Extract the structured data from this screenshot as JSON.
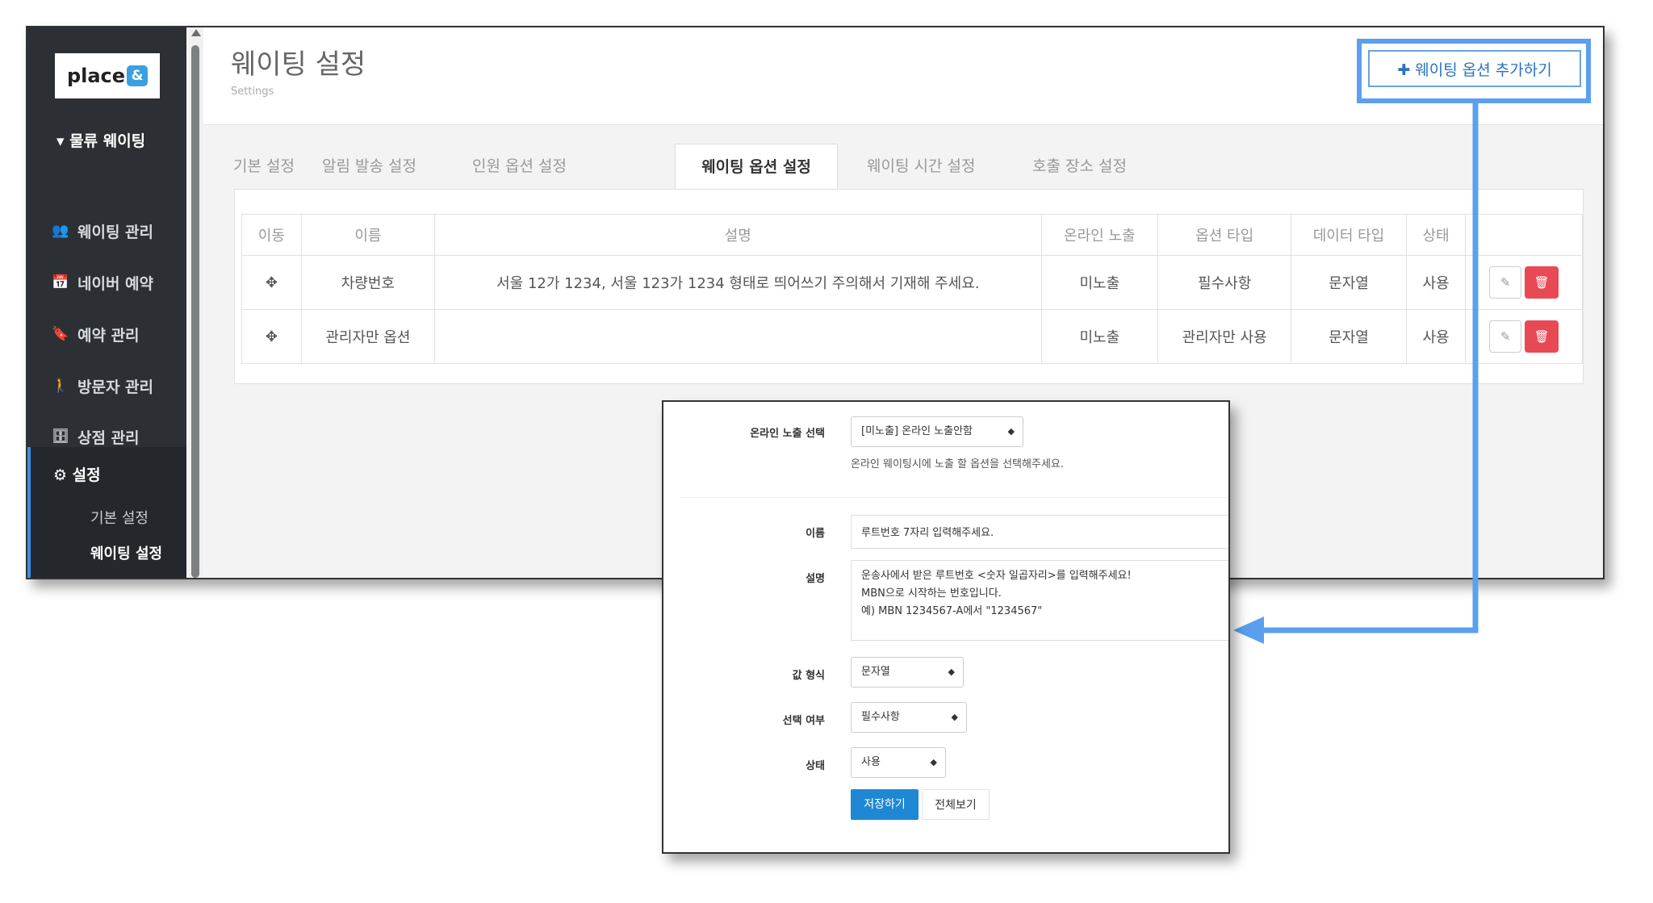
{
  "sidebar": {
    "logo_text": "place",
    "logo_mark": "&",
    "group_label": "▾ 물류 웨이팅",
    "items": [
      {
        "icon": "user-plus-icon",
        "glyph": "👥",
        "label": "웨이팅 관리"
      },
      {
        "icon": "calendar-icon",
        "glyph": "📅",
        "label": "네이버 예약"
      },
      {
        "icon": "bookmark-icon",
        "glyph": "🔖",
        "label": "예약 관리"
      },
      {
        "icon": "person-icon",
        "glyph": "🚶",
        "label": "방문자 관리"
      },
      {
        "icon": "store-icon",
        "glyph": "🗄",
        "label": "상점 관리"
      }
    ],
    "settings": {
      "icon": "gear-icon",
      "label": "설정",
      "subitems": [
        "기본 설정",
        "웨이팅 설정"
      ]
    }
  },
  "header": {
    "title": "웨이팅 설정",
    "subtitle": "Settings",
    "add_button": "✚ 웨이팅 옵션 추가하기"
  },
  "tabs": [
    "기본 설정",
    "알림 발송 설정",
    "인원 옵션 설정",
    "웨이팅 옵션 설정",
    "웨이팅 시간 설정",
    "호출 장소 설정"
  ],
  "table": {
    "headers": [
      "이동",
      "이름",
      "설명",
      "온라인 노출",
      "옵션 타입",
      "데이터 타입",
      "상태",
      ""
    ],
    "rows": [
      {
        "name": "차량번호",
        "description": "서울 12가 1234, 서울 123가 1234 형태로 띄어쓰기 주의해서 기재해 주세요.",
        "online": "미노출",
        "option_type": "필수사항",
        "data_type": "문자열",
        "status": "사용"
      },
      {
        "name": "관리자만 옵션",
        "description": "",
        "online": "미노출",
        "option_type": "관리자만 사용",
        "data_type": "문자열",
        "status": "사용"
      }
    ]
  },
  "form": {
    "online_label": "온라인 노출 선택",
    "online_value": "[미노출] 온라인 노출안함",
    "online_help": "온라인 웨이팅시에 노출 할 옵션을 선택해주세요.",
    "name_label": "이름",
    "name_value": "루트번호 7자리 입력해주세요.",
    "desc_label": "설명",
    "desc_lines": [
      "운송사에서 받은 루트번호 <숫자 일곱자리>를 입력해주세요!",
      "MBN으로 시작하는 번호입니다.",
      "예) MBN 1234567-A에서 \"1234567\""
    ],
    "format_label": "값 형식",
    "format_value": "문자열",
    "required_label": "선택 여부",
    "required_value": "필수사항",
    "status_label": "상태",
    "status_value": "사용",
    "save_button": "저장하기",
    "view_all_button": "전체보기"
  },
  "colors": {
    "highlight": "#5aa0ee",
    "sidebar": "#2c3035",
    "delete": "#e84a55",
    "primary": "#1e88d4"
  }
}
